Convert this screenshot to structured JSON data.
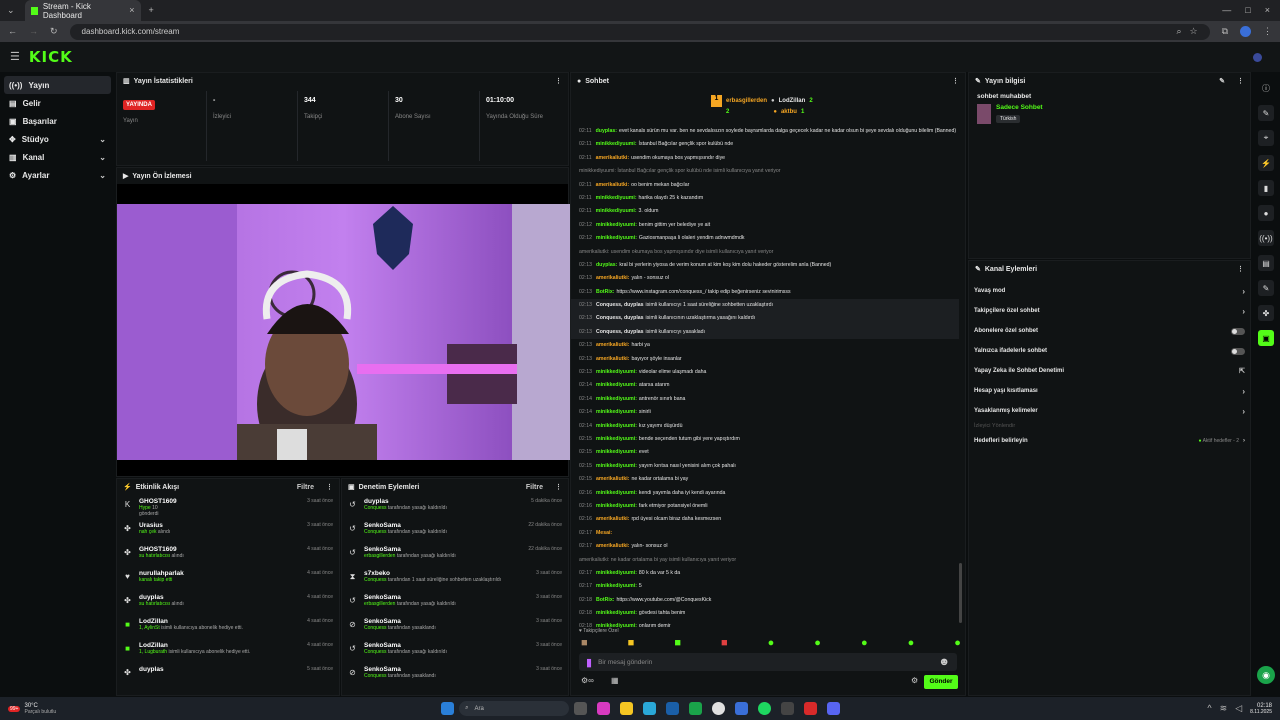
{
  "browser": {
    "tab_title": "Stream - Kick Dashboard",
    "url": "dashboard.kick.com/stream"
  },
  "logo": "KICK",
  "sidebar": {
    "items": [
      {
        "label": "Yayın",
        "icon": "stream-icon"
      },
      {
        "label": "Gelir",
        "icon": "revenue-icon"
      },
      {
        "label": "Başarılar",
        "icon": "achievements-icon"
      },
      {
        "label": "Stüdyo",
        "icon": "studio-icon"
      },
      {
        "label": "Kanal",
        "icon": "channel-icon"
      },
      {
        "label": "Ayarlar",
        "icon": "settings-icon"
      }
    ]
  },
  "stats": {
    "title": "Yayın İstatistikleri",
    "live_badge": "YAYINDA",
    "items": [
      {
        "value": "",
        "label": "Yayın"
      },
      {
        "value": "-",
        "label": "İzleyici"
      },
      {
        "value": "344",
        "label": "Takipçi"
      },
      {
        "value": "30",
        "label": "Abone Sayısı"
      },
      {
        "value": "01:10:00",
        "label": "Yayında Olduğu Süre"
      }
    ]
  },
  "preview": {
    "title": "Yayın Ön İzlemesi"
  },
  "activity": {
    "title": "Etkinlik Akışı",
    "filter": "Filtre",
    "rows": [
      {
        "name": "GHOST1609",
        "sub": "Hype",
        "sub2": "10",
        "sub3": "gönderdi",
        "time": "3 saat önce",
        "icon": "kick-icon"
      },
      {
        "name": "Urasius",
        "sub": "nah çek",
        "sub2": "alındı",
        "time": "3 saat önce",
        "icon": "gift-icon"
      },
      {
        "name": "GHOST1609",
        "sub": "su hatırlatıcısı",
        "sub2": "alındı",
        "time": "4 saat önce",
        "icon": "gift-icon"
      },
      {
        "name": "nurullahparlak",
        "sub": "kanalı takip etti",
        "sub2": "",
        "time": "4 saat önce",
        "icon": "heart-icon"
      },
      {
        "name": "duyplas",
        "sub": "su hatırlatıcısı",
        "sub2": "alındı",
        "time": "4 saat önce",
        "icon": "gift-icon"
      },
      {
        "name": "LodZillan",
        "sub": "1, AylinSt",
        "sub2": "isimli kullanıcıya abonelik hediye etti.",
        "time": "4 saat önce",
        "icon": "sub-gift-icon"
      },
      {
        "name": "LodZillan",
        "sub": "1, Lugburath",
        "sub2": "isimli kullanıcıya abonelik hediye etti.",
        "time": "4 saat önce",
        "icon": "sub-gift-icon"
      },
      {
        "name": "duyplas",
        "sub": "",
        "sub2": "",
        "time": "5 saat önce",
        "icon": "gift-icon"
      }
    ]
  },
  "moderation": {
    "title": "Denetim Eylemleri",
    "filter": "Filtre",
    "rows": [
      {
        "name": "duyplas",
        "sub": "Conquess",
        "sub2": "tarafından yasağı kaldırıldı",
        "time": "5 dakika önce",
        "icon": "undo-icon"
      },
      {
        "name": "SenkoSama",
        "sub": "Conquess",
        "sub2": "tarafından yasağı kaldırıldı",
        "time": "22 dakika önce",
        "icon": "undo-icon"
      },
      {
        "name": "SenkoSama",
        "sub": "erbasgillerden",
        "sub2": "tarafından yasağı kaldırıldı",
        "time": "22 dakika önce",
        "icon": "undo-icon"
      },
      {
        "name": "s7xbeko",
        "sub": "Conquess",
        "sub2": "tarafından 1 saat süreliğine sohbetten uzaklaştırıldı",
        "time": "3 saat önce",
        "icon": "timeout-icon"
      },
      {
        "name": "SenkoSama",
        "sub": "erbasgillerden",
        "sub2": "tarafından yasağı kaldırıldı",
        "time": "3 saat önce",
        "icon": "undo-icon"
      },
      {
        "name": "SenkoSama",
        "sub": "Conquess",
        "sub2": "tarafından yasaklandı",
        "time": "3 saat önce",
        "icon": "ban-icon"
      },
      {
        "name": "SenkoSama",
        "sub": "Conquess",
        "sub2": "tarafından yasağı kaldırıldı",
        "time": "3 saat önce",
        "icon": "undo-icon"
      },
      {
        "name": "SenkoSama",
        "sub": "Conquess",
        "sub2": "tarafından yasaklandı",
        "time": "3 saat önce",
        "icon": "ban-icon"
      }
    ]
  },
  "chat": {
    "title": "Sohbet",
    "top": [
      {
        "name": "erbasgillerden",
        "count": "2"
      },
      {
        "name": "LodZillan",
        "count": "2"
      },
      {
        "name": "aktbu",
        "count": "1"
      }
    ],
    "messages": [
      {
        "t": "02:11",
        "u": "duyplas:",
        "c": "g",
        "m": "evet kanals sürün mu var. ben ne sevdalısızın soylede bayramlarda dalga geçecek kadar ne kadar olsun bi şeye sevdalı olduğunu bilelim (Banned)"
      },
      {
        "t": "02:11",
        "u": "minikkediyuumi:",
        "c": "g",
        "m": "İstanbul Bağcılar gençlik spor kulübü nde"
      },
      {
        "t": "02:11",
        "u": "amerikaliutki:",
        "c": "o",
        "m": "usendim okumaya bos yapmışsındır diye"
      },
      {
        "t": "",
        "u": "",
        "c": "sys",
        "m": "minikkediyuumi: İstanbul Bağcılar gençlik spor kulübü nde isimli kullanıcıya yanıt veriyor"
      },
      {
        "t": "02:11",
        "u": "amerikaliutki:",
        "c": "o",
        "m": "oo benim mekan bağcılar"
      },
      {
        "t": "02:11",
        "u": "minikkediyuumi:",
        "c": "g",
        "m": "harika olaydı 25 k kazandım"
      },
      {
        "t": "02:11",
        "u": "minikkediyuumi:",
        "c": "g",
        "m": "3. oldum"
      },
      {
        "t": "02:12",
        "u": "minikkediyuumi:",
        "c": "g",
        "m": "benim gittim yer belediye ye ait"
      },
      {
        "t": "02:12",
        "u": "minikkediyuumi:",
        "c": "g",
        "m": "Gaziosmanpaşa li olaleri yendim adnwmdmdk"
      },
      {
        "t": "",
        "u": "",
        "c": "sys",
        "m": "amerikaliutki: usendim okumaya bos yapmışsındır diye isimli kullanıcıya yanıt veriyor"
      },
      {
        "t": "02:13",
        "u": "duyplas:",
        "c": "g",
        "m": "kral bi yerlerin yiyosa de verim konum at kim koş kim dolu hakeder gösterelim anla (Banned)"
      },
      {
        "t": "02:13",
        "u": "amerikaliutki:",
        "c": "o",
        "m": "yalın - sonsuz ol"
      },
      {
        "t": "02:13",
        "u": "BotRix:",
        "c": "g",
        "m": "https://www.instagram.com/conquess_/ takip edip beğenirseniz sevinirimsss"
      },
      {
        "t": "02:13",
        "u": "Conquess, duyplas",
        "c": "w",
        "m": "isimli kullanıcıyı 1 saat süreliğine sohbetten uzaklaştırdı",
        "hl": true
      },
      {
        "t": "02:13",
        "u": "Conquess, duyplas",
        "c": "w",
        "m": "isimli kullanıcının uzaklaştırma yasağını kaldırdı",
        "hl": true
      },
      {
        "t": "02:13",
        "u": "Conquess, duyplas",
        "c": "w",
        "m": "isimli kullanıcıyı yasakladı",
        "hl": true
      },
      {
        "t": "02:13",
        "u": "amerikaliutki:",
        "c": "o",
        "m": "harbi ya"
      },
      {
        "t": "02:13",
        "u": "amerikaliutki:",
        "c": "o",
        "m": "bayıyor şöyle insanlar"
      },
      {
        "t": "02:13",
        "u": "minikkediyuumi:",
        "c": "g",
        "m": "videolar elime ulaşmadı daha"
      },
      {
        "t": "02:14",
        "u": "minikkediyuumi:",
        "c": "g",
        "m": "atarsa atarım"
      },
      {
        "t": "02:14",
        "u": "minikkediyuumi:",
        "c": "g",
        "m": "antrenör sınırlı bana"
      },
      {
        "t": "02:14",
        "u": "minikkediyuumi:",
        "c": "g",
        "m": "sinirli"
      },
      {
        "t": "02:14",
        "u": "minikkediyuumi:",
        "c": "g",
        "m": "kız yayımı düşürdü"
      },
      {
        "t": "02:15",
        "u": "minikkediyuumi:",
        "c": "g",
        "m": "bende seçenden tutum gibi yere yapıştırdım"
      },
      {
        "t": "02:15",
        "u": "minikkediyuumi:",
        "c": "g",
        "m": "evet"
      },
      {
        "t": "02:15",
        "u": "minikkediyuumi:",
        "c": "g",
        "m": "yayım kırıtsa nasıl yenisini alım çok pahalı"
      },
      {
        "t": "02:15",
        "u": "amerikaliutki:",
        "c": "o",
        "m": "ne kadar ortalama bi yay"
      },
      {
        "t": "02:16",
        "u": "minikkediyuumi:",
        "c": "g",
        "m": "kendi yayımla daha iyi kendi ayarında"
      },
      {
        "t": "02:16",
        "u": "minikkediyuumi:",
        "c": "g",
        "m": "fark etmiyor potansiyel önemli"
      },
      {
        "t": "02:16",
        "u": "amerikaliutki:",
        "c": "o",
        "m": "rpd üyesi olcam biraz daha kesmezsen"
      },
      {
        "t": "02:17",
        "u": "Mesai:",
        "c": "o",
        "m": ""
      },
      {
        "t": "02:17",
        "u": "amerikaliutki:",
        "c": "o",
        "m": "yalın- sonsuz ol"
      },
      {
        "t": "",
        "u": "",
        "c": "sys",
        "m": "amerikaliutki: ne kadar ortalama bi yay isimli kullanıcıya yanıt veriyor"
      },
      {
        "t": "02:17",
        "u": "minikkediyuumi:",
        "c": "g",
        "m": "80 k da var 5 k da"
      },
      {
        "t": "02:17",
        "u": "minikkediyuumi:",
        "c": "g",
        "m": "5"
      },
      {
        "t": "02:18",
        "u": "BotRix:",
        "c": "g",
        "m": "https://www.youtube.com/@ConquesKick"
      },
      {
        "t": "02:18",
        "u": "minikkediyuumi:",
        "c": "g",
        "m": "gövdesi tahta benim"
      },
      {
        "t": "02:18",
        "u": "minikkediyuumi:",
        "c": "g",
        "m": "onlarım demir"
      }
    ],
    "followers_only": "Takipçilere Özel",
    "input_placeholder": "Bir mesaj gönderin",
    "send": "Gönder"
  },
  "stream_info": {
    "title": "Yayın bilgisi",
    "stream_title": "sohbet muhabbet",
    "category": "Sadece Sohbet",
    "language": "Türkish"
  },
  "channel_actions": {
    "title": "Kanal Eylemleri",
    "rows": [
      {
        "label": "Yavaş mod",
        "ctrl": "chevron"
      },
      {
        "label": "Takipçilere özel sohbet",
        "ctrl": "chevron"
      },
      {
        "label": "Abonelere özel sohbet",
        "ctrl": "toggle"
      },
      {
        "label": "Yalnızca ifadelerle sohbet",
        "ctrl": "toggle"
      },
      {
        "label": "Yapay Zeka ile Sohbet Denetimi",
        "ctrl": "external"
      },
      {
        "label": "Hesap yaşı kısıtlaması",
        "ctrl": "chevron"
      },
      {
        "label": "Yasaklanmış kelimeler",
        "ctrl": "chevron"
      }
    ],
    "section": "İzleyici Yönlendir",
    "goals": "Hedefleri belirleyin",
    "goals_badge": "Aktif hedefler - 2"
  },
  "taskbar": {
    "weather": "30°C",
    "weather_sub": "Parçalı bulutlu",
    "search": "Ara",
    "time": "02:18",
    "date": "8.11.2025",
    "notif": "99+"
  }
}
